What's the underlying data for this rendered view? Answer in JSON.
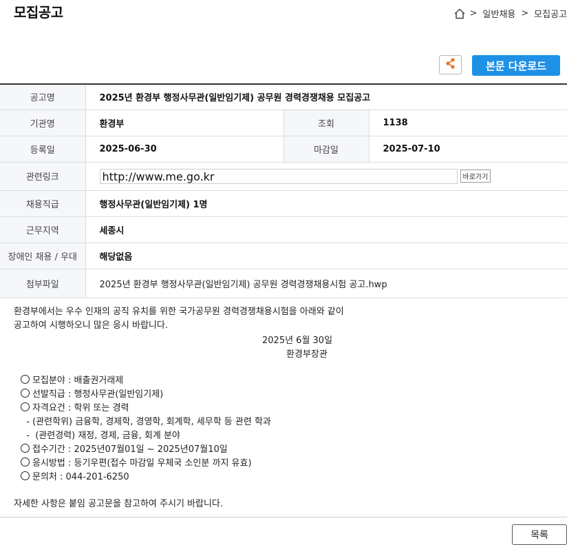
{
  "page": {
    "title": "모집공고"
  },
  "breadcrumb": {
    "sep1": ">",
    "item1": "일반채용",
    "sep2": ">",
    "item2": "모집공고"
  },
  "toolbar": {
    "share_icon": "share-icon",
    "download_label": "본문 다운로드",
    "accent": "#1e90e6"
  },
  "info": {
    "title_label": "공고명",
    "title_value": "2025년 환경부 행정사무관(일반임기제) 공무원 경력경쟁채용 모집공고",
    "agency_label": "기관명",
    "agency_value": "환경부",
    "views_label": "조회",
    "views_value": "1138",
    "registered_label": "등록일",
    "registered_value": "2025-06-30",
    "deadline_label": "마감일",
    "deadline_value": "2025-07-10",
    "link_label": "관련링크",
    "link_value": "http://www.me.go.kr",
    "go_label": "바로가기",
    "position_label": "채용직급",
    "position_value": "행정사무관(일반임기제) 1명",
    "location_label": "근무지역",
    "location_value": "세종시",
    "disability_label": "장애인 채용 / 우대",
    "disability_value": "해당없음",
    "attachment_label": "첨부파일",
    "attachment_value": "2025년 환경부 행정사무관(일반임기제) 공무원 경력경쟁채용시험 공고.hwp"
  },
  "body": {
    "intro_line1": "환경부에서는 우수 인재의 공직 유치를 위한 국가공무원 경력경쟁채용시험을 아래와 같이",
    "intro_line2": "공고하여 시행하오니 많은 응시 바랍니다.",
    "date": "2025년 6월 30일",
    "signer": "환경부장관",
    "items": [
      "모집분야 : 배출권거래제",
      "선발직급 : 행정사무관(일반임기제)",
      "자격요건 : 학위 또는 경력",
      "  - (관련학위) 금융학, 경제학, 경영학, 회계학, 세무학 등 관련 학과",
      "  -  (관련경력) 재정, 경제, 금융, 회계 분야",
      "접수기간 : 2025년07월01일 ~ 2025년07월10일",
      "응시방법 : 등기우편(접수 마감일 우체국 소인분 까지 유효)",
      "문의처 : 044-201-6250"
    ],
    "closing": "자세한 사항은 붙임 공고문을 참고하여 주시기 바랍니다."
  },
  "footer": {
    "list_label": "목록"
  }
}
